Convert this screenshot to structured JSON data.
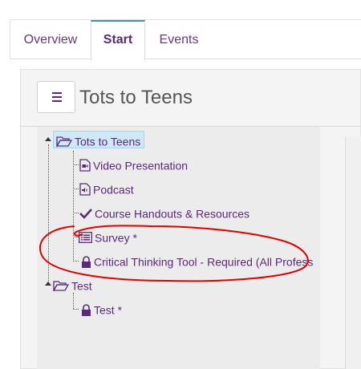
{
  "tabs": [
    {
      "label": "Overview",
      "active": false
    },
    {
      "label": "Start",
      "active": true
    },
    {
      "label": "Events",
      "active": false
    }
  ],
  "header": {
    "title": "Tots to Teens",
    "menu_icon": "hamburger-icon"
  },
  "tree": {
    "root": {
      "label": "Tots to Teens",
      "icon": "folder-open-icon",
      "selected": true
    },
    "items": [
      {
        "label": "Video Presentation",
        "icon": "video-file-icon"
      },
      {
        "label": "Podcast",
        "icon": "audio-file-icon"
      },
      {
        "label": "Course Handouts & Resources",
        "icon": "checkmark-icon"
      },
      {
        "label": "Survey *",
        "icon": "survey-list-icon"
      },
      {
        "label": "Critical Thinking Tool - Required (All Profess",
        "icon": "lock-icon"
      }
    ],
    "second_folder": {
      "label": "Test",
      "icon": "folder-open-icon"
    },
    "second_items": [
      {
        "label": "Test *",
        "icon": "lock-icon"
      }
    ]
  },
  "colors": {
    "accent": "#5a2a7a",
    "tab_indicator": "#4a9696",
    "selection": "#cde8f6",
    "annotation": "#e00000"
  }
}
